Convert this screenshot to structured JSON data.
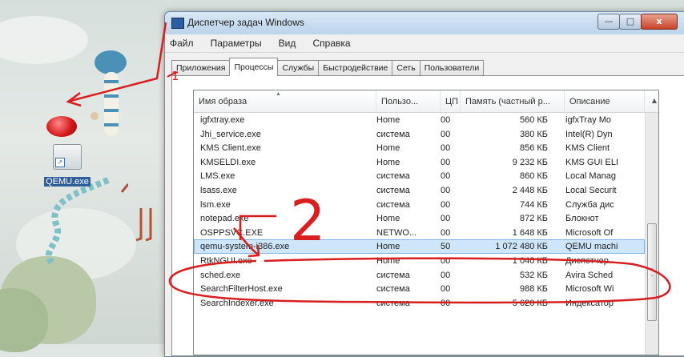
{
  "desktop": {
    "icon_label": "QEMU.exe"
  },
  "window": {
    "title": "Диспетчер задач Windows",
    "controls": {
      "minimize": "—",
      "maximize": "□",
      "close": "x"
    }
  },
  "menu": [
    "Файл",
    "Параметры",
    "Вид",
    "Справка"
  ],
  "tabs": [
    {
      "label": "Приложения"
    },
    {
      "label": "Процессы"
    },
    {
      "label": "Службы"
    },
    {
      "label": "Быстродействие"
    },
    {
      "label": "Сеть"
    },
    {
      "label": "Пользователи"
    }
  ],
  "active_tab": "Процессы",
  "table": {
    "columns": [
      "Имя образа",
      "Пользо...",
      "ЦП",
      "Память (частный р...",
      "Описание"
    ],
    "rows": [
      {
        "name": "igfxtray.exe",
        "user": "Home",
        "cpu": "00",
        "mem": "560 КБ",
        "desc": "igfxTray Mo"
      },
      {
        "name": "Jhi_service.exe",
        "user": "система",
        "cpu": "00",
        "mem": "380 КБ",
        "desc": "Intel(R) Dyn"
      },
      {
        "name": "KMS Client.exe",
        "user": "Home",
        "cpu": "00",
        "mem": "856 КБ",
        "desc": "KMS Client"
      },
      {
        "name": "KMSELDI.exe",
        "user": "Home",
        "cpu": "00",
        "mem": "9 232 КБ",
        "desc": "KMS GUI ELI"
      },
      {
        "name": "LMS.exe",
        "user": "система",
        "cpu": "00",
        "mem": "860 КБ",
        "desc": "Local Manag"
      },
      {
        "name": "lsass.exe",
        "user": "система",
        "cpu": "00",
        "mem": "2 448 КБ",
        "desc": "Local Securit"
      },
      {
        "name": "lsm.exe",
        "user": "система",
        "cpu": "00",
        "mem": "744 КБ",
        "desc": "Служба дис"
      },
      {
        "name": "notepad.exe",
        "user": "Home",
        "cpu": "00",
        "mem": "872 КБ",
        "desc": "Блокнот"
      },
      {
        "name": "OSPPSVC.EXE",
        "user": "NETWO...",
        "cpu": "00",
        "mem": "1 648 КБ",
        "desc": "Microsoft Of"
      },
      {
        "name": "qemu-system-i386.exe",
        "user": "Home",
        "cpu": "50",
        "mem": "1 072 480 КБ",
        "desc": "QEMU machi"
      },
      {
        "name": "RtkNGUI.exe",
        "user": "Home",
        "cpu": "00",
        "mem": "1 040 КБ",
        "desc": "Диспетчер"
      },
      {
        "name": "sched.exe",
        "user": "система",
        "cpu": "00",
        "mem": "532 КБ",
        "desc": "Avira Sched"
      },
      {
        "name": "SearchFilterHost.exe",
        "user": "система",
        "cpu": "00",
        "mem": "988 КБ",
        "desc": "Microsoft Wi"
      },
      {
        "name": "SearchIndexer.exe",
        "user": "система",
        "cpu": "00",
        "mem": "5 620 КБ",
        "desc": "Индексатор"
      }
    ],
    "selected_row": "qemu-system-i386.exe"
  },
  "annotations": {
    "label_1": "1",
    "label_2": "2",
    "color": "#d81e1e"
  }
}
